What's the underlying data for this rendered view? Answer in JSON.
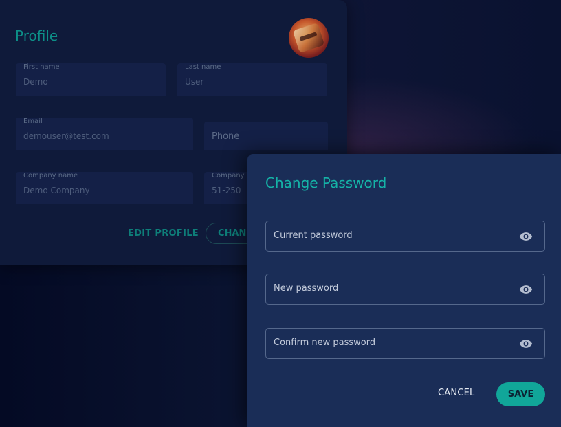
{
  "profile": {
    "title": "Profile",
    "fields": {
      "first_name": {
        "label": "First name",
        "value": "Demo"
      },
      "last_name": {
        "label": "Last name",
        "value": "User"
      },
      "email": {
        "label": "Email",
        "value": "demouser@test.com"
      },
      "phone": {
        "placeholder": "Phone"
      },
      "company_name": {
        "label": "Company name",
        "value": "Demo Company"
      },
      "company_size": {
        "label": "Company S",
        "value": "51-250"
      }
    },
    "edit_button": "EDIT PROFILE",
    "change_password_button": "CHANG"
  },
  "modal": {
    "title": "Change Password",
    "current_password_label": "Current password",
    "new_password_label": "New password",
    "confirm_password_label": "Confirm new password",
    "cancel_label": "CANCEL",
    "save_label": "SAVE"
  },
  "colors": {
    "accent": "#11a699",
    "modal_bg": "#1a2d57",
    "page_bg": "#0a1330"
  },
  "icons": {
    "visibility": "eye-icon"
  }
}
